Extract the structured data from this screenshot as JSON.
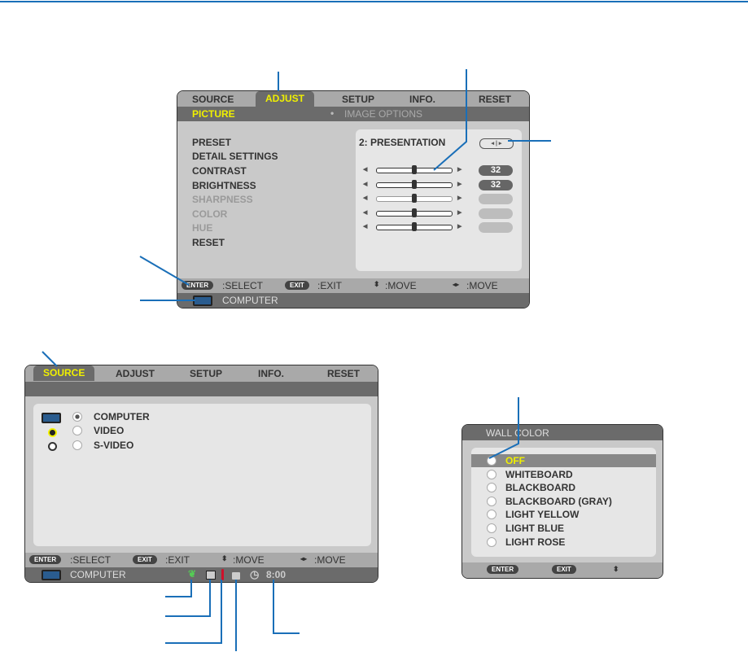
{
  "adjust_menu": {
    "tabs": [
      "SOURCE",
      "ADJUST",
      "SETUP",
      "INFO.",
      "RESET"
    ],
    "active_tab": "ADJUST",
    "subtabs": {
      "picture": "PICTURE",
      "image_options": "IMAGE OPTIONS"
    },
    "items": [
      "PRESET",
      "DETAIL SETTINGS",
      "CONTRAST",
      "BRIGHTNESS",
      "SHARPNESS",
      "COLOR",
      "HUE",
      "RESET"
    ],
    "preset_value": "2:  PRESENTATION",
    "contrast": "32",
    "brightness": "32",
    "slider_levels": {
      "contrast": 0.5,
      "brightness": 0.5,
      "sharpness": 0.5,
      "color": 0.5,
      "hue": 0.5
    },
    "footer": {
      "enter": "ENTER",
      "select": ":SELECT",
      "exit": "EXIT",
      "exit_label": ":EXIT",
      "move1": ":MOVE",
      "move2": ":MOVE"
    },
    "status": "COMPUTER"
  },
  "source_menu": {
    "tabs": [
      "SOURCE",
      "ADJUST",
      "SETUP",
      "INFO.",
      "RESET"
    ],
    "active_tab": "SOURCE",
    "items": [
      "COMPUTER",
      "VIDEO",
      "S-VIDEO"
    ],
    "selected": "COMPUTER",
    "footer": {
      "enter": "ENTER",
      "select": ":SELECT",
      "exit": "EXIT",
      "exit_label": ":EXIT",
      "move1": ":MOVE",
      "move2": ":MOVE"
    },
    "status": "COMPUTER",
    "timer": "8:00"
  },
  "wall_color": {
    "title": "WALL COLOR",
    "options": [
      "OFF",
      "WHITEBOARD",
      "BLACKBOARD",
      "BLACKBOARD (GRAY)",
      "LIGHT YELLOW",
      "LIGHT BLUE",
      "LIGHT ROSE"
    ],
    "selected": "OFF",
    "footer": {
      "enter": "ENTER",
      "exit": "EXIT"
    }
  },
  "colors": {
    "callout": "#1a6fb8",
    "highlight": "#f0f000"
  }
}
